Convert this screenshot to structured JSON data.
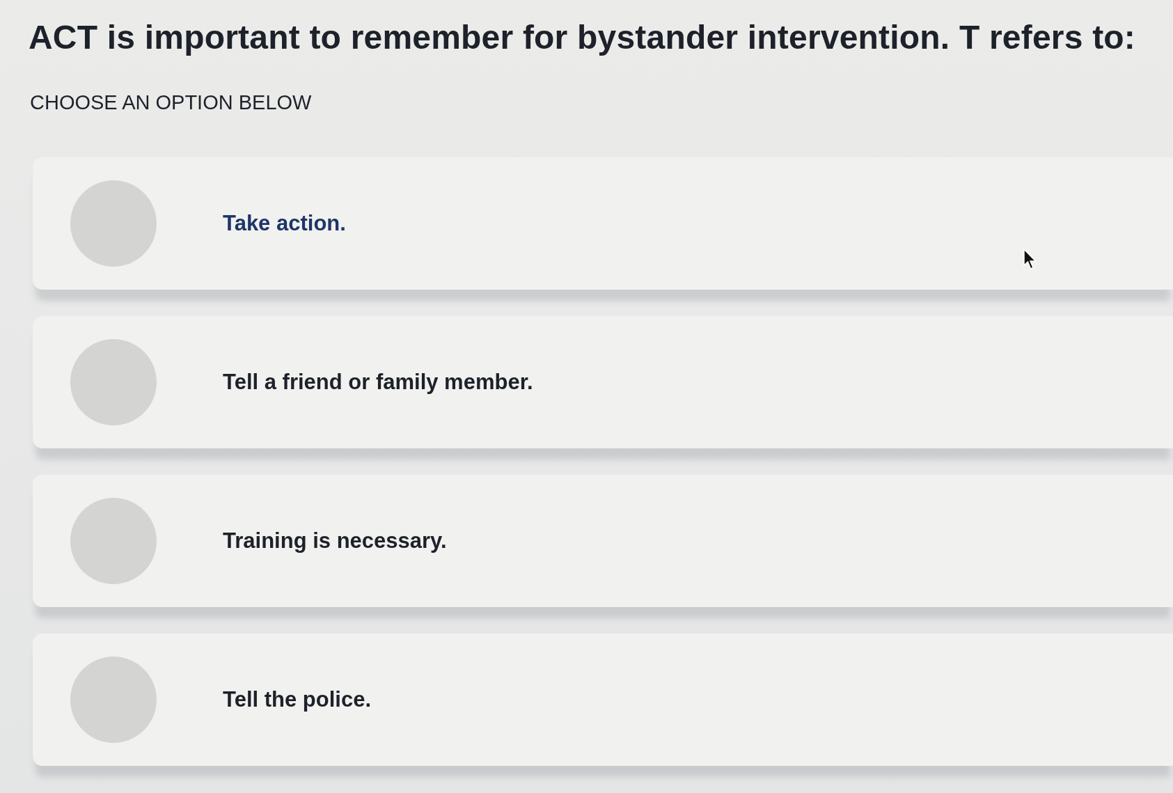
{
  "question": {
    "text": "ACT is important to remember for bystander intervention. T refers to:"
  },
  "instruction": "CHOOSE AN OPTION BELOW",
  "options": [
    {
      "label": "Take action.",
      "selected": false,
      "hovered": true
    },
    {
      "label": "Tell a friend or family member.",
      "selected": false,
      "hovered": false
    },
    {
      "label": "Training is necessary.",
      "selected": false,
      "hovered": false
    },
    {
      "label": "Tell the police.",
      "selected": false,
      "hovered": false
    }
  ]
}
